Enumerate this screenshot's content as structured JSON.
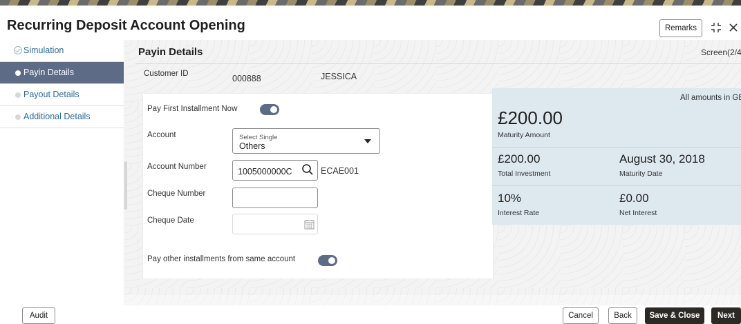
{
  "header": {
    "title": "Recurring Deposit Account Opening",
    "remarks_label": "Remarks",
    "icons": [
      "collapse-icon",
      "close-icon"
    ]
  },
  "sidebar": {
    "items": [
      {
        "label": "Simulation",
        "state": "completed"
      },
      {
        "label": "Payin Details",
        "state": "active"
      },
      {
        "label": "Payout Details",
        "state": "pending"
      },
      {
        "label": "Additional Details",
        "state": "pending"
      }
    ]
  },
  "section": {
    "title": "Payin Details",
    "screen_indicator": "Screen(2/4"
  },
  "customer": {
    "label": "Customer ID",
    "id": "000888",
    "name": "JESSICA"
  },
  "form": {
    "pay_first_label": "Pay First Installment Now",
    "pay_first_on": true,
    "account_label": "Account",
    "account_placeholder": "Select Single",
    "account_value": "Others",
    "account_number_label": "Account Number",
    "account_number_value": "1005000000C",
    "account_code": "ECAE001",
    "cheque_number_label": "Cheque Number",
    "cheque_number_value": "",
    "cheque_date_label": "Cheque Date",
    "cheque_date_value": "",
    "pay_other_label": "Pay other installments from same account",
    "pay_other_on": true
  },
  "summary": {
    "currency_note": "All amounts in GBP",
    "maturity_amount": "£200.00",
    "maturity_amount_label": "Maturity Amount",
    "total_investment": "£200.00",
    "total_investment_label": "Total Investment",
    "maturity_date": "August 30, 2018",
    "maturity_date_label": "Maturity Date",
    "interest_rate": "10%",
    "interest_rate_label": "Interest Rate",
    "net_interest": "£0.00",
    "net_interest_label": "Net Interest"
  },
  "footer": {
    "audit_label": "Audit",
    "cancel_label": "Cancel",
    "back_label": "Back",
    "save_close_label": "Save & Close",
    "next_label": "Next"
  },
  "colors": {
    "accent": "#5e6b87",
    "link": "#2d6a94",
    "summary_bg": "#dde8ef",
    "primary_button": "#2d2a26"
  }
}
